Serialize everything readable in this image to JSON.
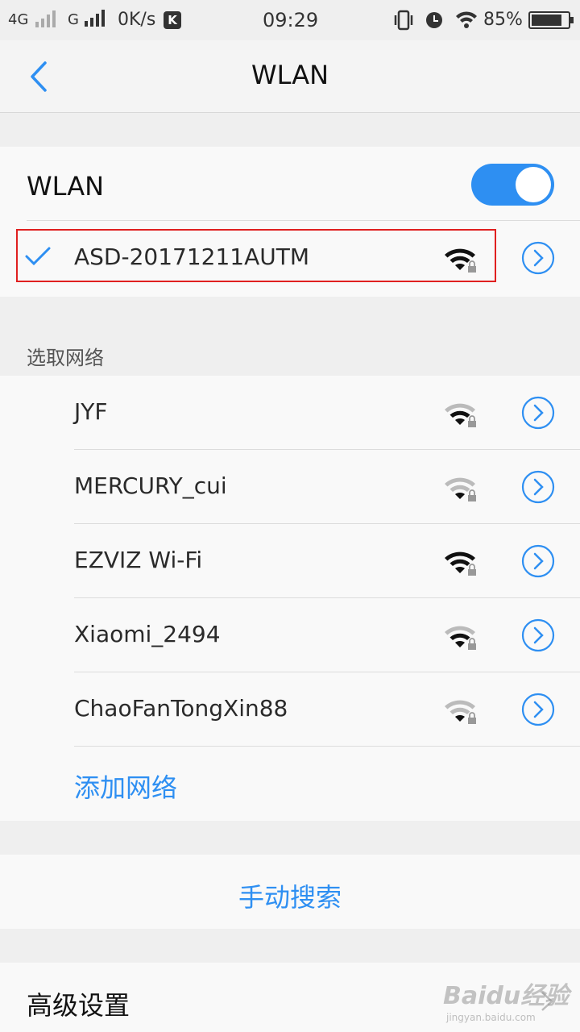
{
  "status_bar": {
    "network1": "4G",
    "network2": "G",
    "speed": "0K/s",
    "k_badge": "K",
    "time": "09:29",
    "battery_pct": "85%",
    "battery_level": 0.85
  },
  "header": {
    "title": "WLAN"
  },
  "wlan": {
    "label": "WLAN",
    "enabled": true,
    "connected": {
      "ssid": "ASD-20171211AUTM",
      "signal_icon": "wifi-full-locked-icon"
    }
  },
  "available": {
    "title": "选取网络",
    "networks": [
      {
        "ssid": "JYF",
        "signal_icon": "wifi-medium-locked-icon"
      },
      {
        "ssid": "MERCURY_cui",
        "signal_icon": "wifi-weak-locked-icon"
      },
      {
        "ssid": "EZVIZ Wi-Fi",
        "signal_icon": "wifi-full-locked-icon"
      },
      {
        "ssid": "Xiaomi_2494",
        "signal_icon": "wifi-medium-locked-icon"
      },
      {
        "ssid": "ChaoFanTongXin88",
        "signal_icon": "wifi-weak-locked-icon"
      }
    ],
    "add_network": "添加网络"
  },
  "manual_search": "手动搜索",
  "advanced": "高级设置",
  "watermark": {
    "main": "Baidu经验",
    "sub": "jingyan.baidu.com"
  },
  "colors": {
    "accent": "#2e8ff2",
    "highlight": "#e02020"
  }
}
